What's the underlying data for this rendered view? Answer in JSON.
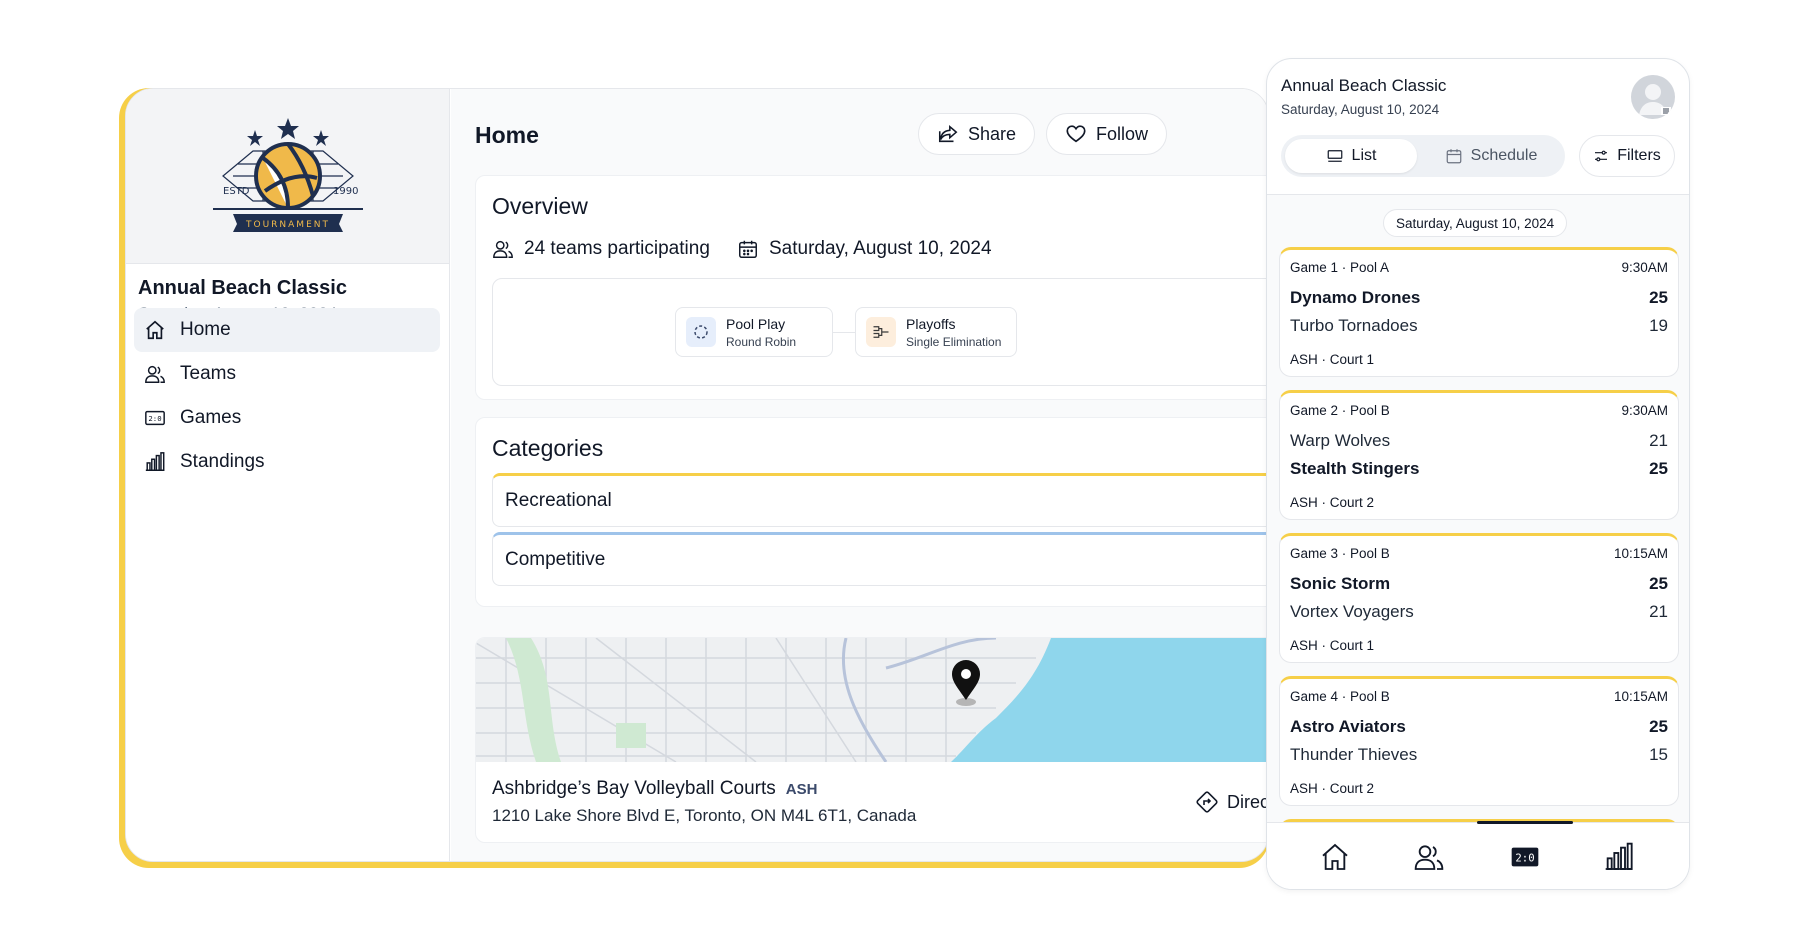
{
  "app": {
    "title": "Annual Beach Classic",
    "date": "Saturday, August 10, 2024",
    "logo": {
      "estd": "ESTD",
      "year": "1990",
      "banner": "TOURNAMENT"
    },
    "accent_color": "#f6cf48"
  },
  "sidebar": {
    "items": [
      {
        "label": "Home",
        "icon": "home-icon",
        "active": true
      },
      {
        "label": "Teams",
        "icon": "users-icon",
        "active": false
      },
      {
        "label": "Games",
        "icon": "scoreboard-icon",
        "active": false
      },
      {
        "label": "Standings",
        "icon": "bar-chart-icon",
        "active": false
      }
    ]
  },
  "header": {
    "title": "Home",
    "share_label": "Share",
    "follow_label": "Follow"
  },
  "overview": {
    "title": "Overview",
    "teams": "24 teams participating",
    "date": "Saturday, August 10, 2024",
    "phases": [
      {
        "title": "Pool Play",
        "subtitle": "Round Robin",
        "icon": "round-robin-icon",
        "color": "#e6eefb"
      },
      {
        "title": "Playoffs",
        "subtitle": "Single Elimination",
        "icon": "bracket-icon",
        "color": "#fdeedd"
      }
    ]
  },
  "categories": {
    "title": "Categories",
    "items": [
      {
        "label": "Recreational",
        "color": "#f6cf48"
      },
      {
        "label": "Competitive",
        "color": "#9ec3ea"
      }
    ]
  },
  "venue": {
    "name": "Ashbridge’s Bay Volleyball Courts",
    "code": "ASH",
    "address": "1210 Lake Shore Blvd E, Toronto, ON M4L 6T1, Canada",
    "directions_label": "Direc"
  },
  "mobile": {
    "tabs": [
      {
        "label": "List",
        "active": true
      },
      {
        "label": "Schedule",
        "active": false
      }
    ],
    "filters_label": "Filters",
    "day_label": "Saturday, August 10, 2024",
    "games": [
      {
        "header": "Game 1 · Pool A",
        "time": "9:30AM",
        "team1": "Dynamo Drones",
        "score1": "25",
        "team2": "Turbo Tornadoes",
        "score2": "19",
        "winner": 1,
        "venue": "ASH · Court 1"
      },
      {
        "header": "Game 2 · Pool B",
        "time": "9:30AM",
        "team1": "Warp Wolves",
        "score1": "21",
        "team2": "Stealth Stingers",
        "score2": "25",
        "winner": 2,
        "venue": "ASH · Court 2"
      },
      {
        "header": "Game 3 · Pool B",
        "time": "10:15AM",
        "team1": "Sonic Storm",
        "score1": "25",
        "team2": "Vortex Voyagers",
        "score2": "21",
        "winner": 1,
        "venue": "ASH · Court 1"
      },
      {
        "header": "Game 4 · Pool B",
        "time": "10:15AM",
        "team1": "Astro Aviators",
        "score1": "25",
        "team2": "Thunder Thieves",
        "score2": "15",
        "winner": 1,
        "venue": "ASH · Court 2"
      }
    ],
    "bottom_nav": [
      {
        "icon": "home-icon",
        "active": false
      },
      {
        "icon": "users-icon",
        "active": false
      },
      {
        "icon": "scoreboard-icon",
        "active": true
      },
      {
        "icon": "bar-chart-icon",
        "active": false
      }
    ]
  }
}
